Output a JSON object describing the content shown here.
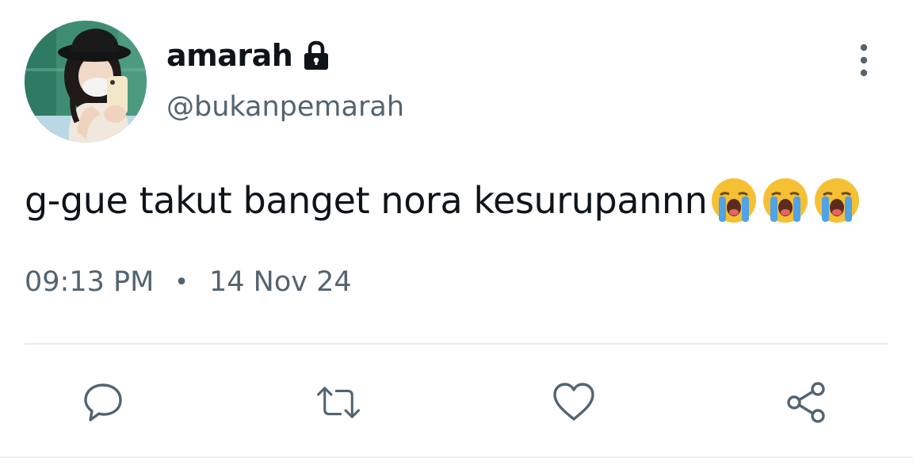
{
  "user": {
    "display_name": "amarah",
    "handle": "@bukanpemarah",
    "protected_icon": "lock-icon",
    "avatar": "profile-photo"
  },
  "tweet": {
    "text": "g-gue takut banget nora kesurupannn",
    "emojis": [
      "loudly-crying-face",
      "loudly-crying-face",
      "loudly-crying-face"
    ],
    "time": "09:13 PM",
    "separator": "•",
    "date": "14 Nov 24"
  },
  "actions": [
    {
      "name": "reply",
      "icon": "comment-icon"
    },
    {
      "name": "retweet",
      "icon": "retweet-icon"
    },
    {
      "name": "like",
      "icon": "heart-icon"
    },
    {
      "name": "share",
      "icon": "share-icon"
    }
  ],
  "menu_icon": "more-vertical-icon",
  "colors": {
    "text_primary": "#0f1419",
    "text_secondary": "#536471",
    "divider": "#e6e9eb",
    "background": "#ffffff"
  }
}
